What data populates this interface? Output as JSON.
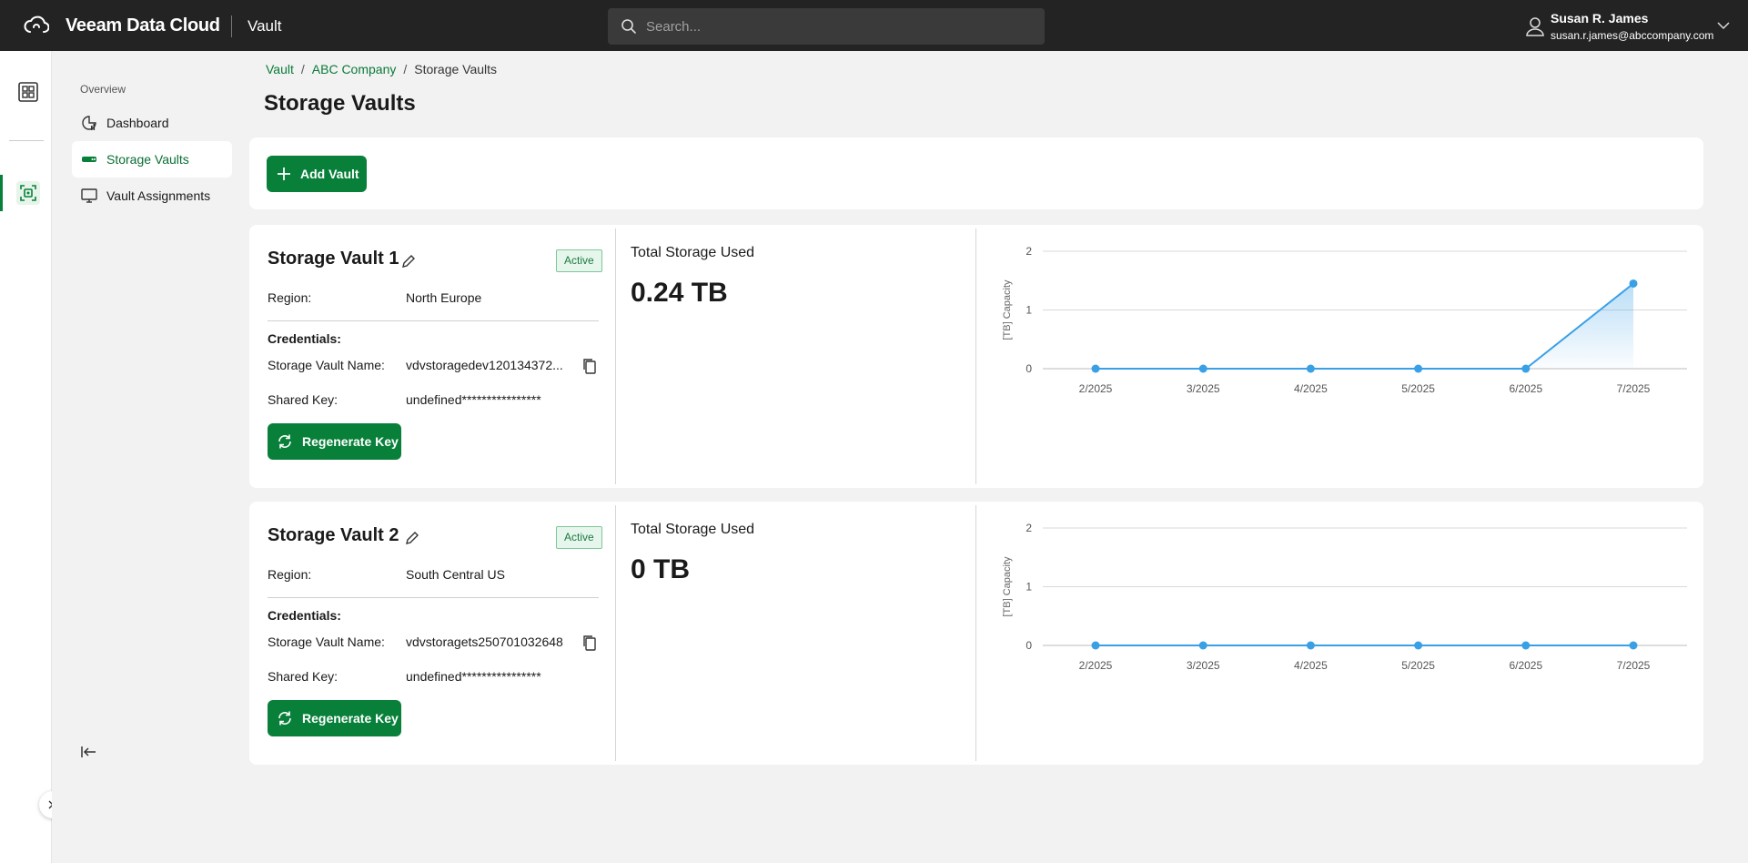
{
  "topbar": {
    "brand": "Veeam Data Cloud",
    "app": "Vault",
    "search_placeholder": "Search...",
    "user_name": "Susan R. James",
    "user_email": "susan.r.james@abccompany.com"
  },
  "nav": {
    "section": "Overview",
    "items": [
      {
        "label": "Dashboard",
        "icon": "dashboard-chart-icon"
      },
      {
        "label": "Storage Vaults",
        "icon": "storage-icon",
        "active": true
      },
      {
        "label": "Vault Assignments",
        "icon": "monitor-icon"
      }
    ]
  },
  "breadcrumb": [
    "Vault",
    "ABC Company",
    "Storage Vaults"
  ],
  "page_title": "Storage Vaults",
  "toolbar": {
    "add_label": "Add Vault"
  },
  "labels": {
    "region": "Region:",
    "credentials": "Credentials:",
    "vault_name": "Storage Vault Name:",
    "shared_key": "Shared Key:",
    "regenerate": "Regenerate Key",
    "total_storage": "Total Storage Used"
  },
  "vaults": [
    {
      "name": "Storage Vault 1",
      "status": "Active",
      "region": "North Europe",
      "vault_name": "vdvstoragedev120134372...",
      "shared_key": "undefined****************",
      "total": "0.24 TB"
    },
    {
      "name": "Storage Vault 2",
      "status": "Active",
      "region": "South Central US",
      "vault_name": "vdvstoragets250701032648",
      "shared_key": "undefined****************",
      "total": "0 TB"
    }
  ],
  "colors": {
    "accent": "#08803a",
    "chart_line": "#3aa0e6",
    "topbar": "#232323"
  },
  "chart_data": [
    {
      "type": "area",
      "ylabel": "[TB] Capacity",
      "x": [
        "2/2025",
        "3/2025",
        "4/2025",
        "5/2025",
        "6/2025",
        "7/2025"
      ],
      "y_ticks": [
        "0",
        "1",
        "2"
      ],
      "ylim": [
        0,
        2
      ],
      "series": [
        {
          "values": [
            0,
            0,
            0,
            0,
            0,
            1.45
          ]
        }
      ],
      "grid": true
    },
    {
      "type": "area",
      "ylabel": "[TB] Capacity",
      "x": [
        "2/2025",
        "3/2025",
        "4/2025",
        "5/2025",
        "6/2025",
        "7/2025"
      ],
      "y_ticks": [
        "0",
        "1",
        "2"
      ],
      "ylim": [
        0,
        2
      ],
      "series": [
        {
          "values": [
            0,
            0,
            0,
            0,
            0,
            0
          ]
        }
      ],
      "grid": true
    }
  ]
}
